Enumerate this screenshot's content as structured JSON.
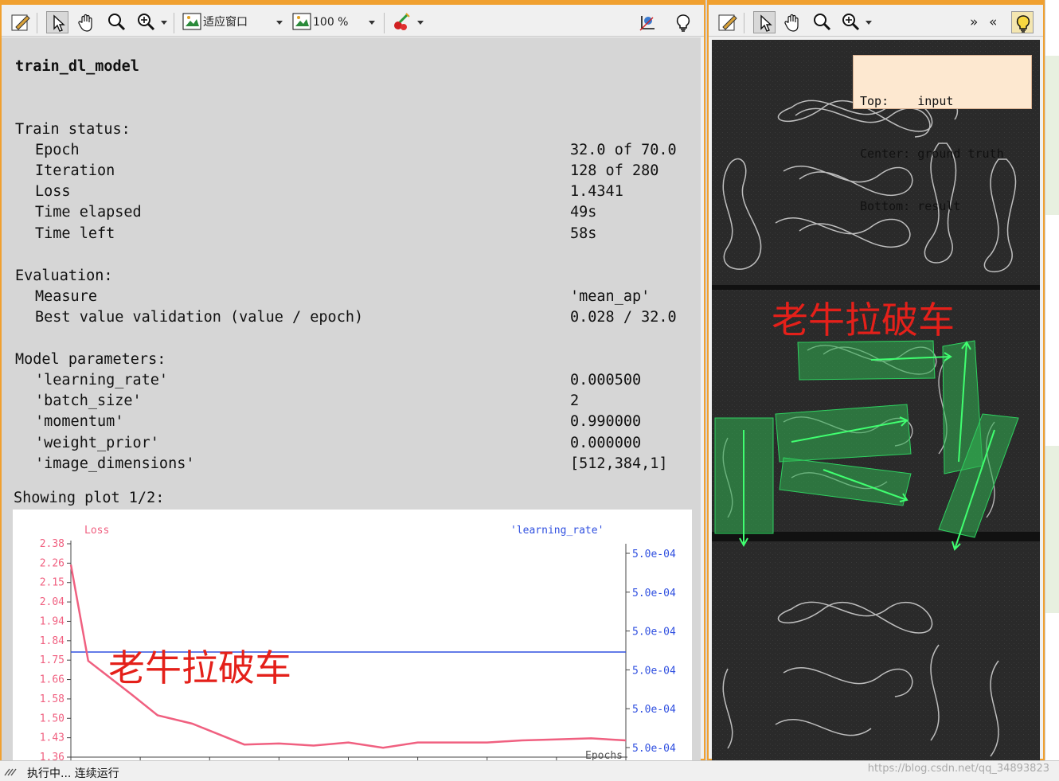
{
  "left_window": {
    "toolbar": {
      "zoom_mode": "适应窗口",
      "zoom_percent": "100 %"
    },
    "title": "train_dl_model",
    "train_status": {
      "heading": "Train status:",
      "rows": [
        {
          "label": "Epoch",
          "value": "32.0 of 70.0"
        },
        {
          "label": "Iteration",
          "value": "128 of 280"
        },
        {
          "label": "Loss",
          "value": "1.4341"
        },
        {
          "label": "Time elapsed",
          "value": "49s"
        },
        {
          "label": "Time left",
          "value": "58s"
        }
      ]
    },
    "evaluation": {
      "heading": "Evaluation:",
      "rows": [
        {
          "label": "Measure",
          "value": "'mean_ap'"
        },
        {
          "label": "Best value validation (value / epoch)",
          "value": "0.028 / 32.0"
        }
      ]
    },
    "model_parameters": {
      "heading": "Model parameters:",
      "rows": [
        {
          "label": "'learning_rate'",
          "value": "0.000500"
        },
        {
          "label": "'batch_size'",
          "value": "2"
        },
        {
          "label": "'momentum'",
          "value": "0.990000"
        },
        {
          "label": "'weight_prior'",
          "value": "0.000000"
        },
        {
          "label": "'image_dimensions'",
          "value": "[512,384,1]"
        }
      ]
    },
    "plot_caption": "Showing plot 1/2:",
    "watermark": "老牛拉破车"
  },
  "chart_data": {
    "type": "line",
    "left_series_label": "Loss",
    "right_series_label": "'learning_rate'",
    "xlabel": "Epochs",
    "left_axis_ticks": [
      "2.38",
      "2.26",
      "2.15",
      "2.04",
      "1.94",
      "1.84",
      "1.75",
      "1.66",
      "1.58",
      "1.50",
      "1.43",
      "1.36"
    ],
    "right_axis_ticks": [
      "5.0e-04",
      "5.0e-04",
      "5.0e-04",
      "5.0e-04",
      "5.0e-04",
      "5.0e-04"
    ],
    "ylim_left": [
      1.36,
      2.38
    ],
    "xlim": [
      0,
      32
    ],
    "series": [
      {
        "name": "Loss",
        "color": "#f06080",
        "x": [
          0,
          1,
          3.5,
          5,
          7,
          10,
          12,
          14,
          16,
          18,
          20,
          22,
          24,
          26,
          28,
          30,
          32
        ],
        "y": [
          2.28,
          1.82,
          1.66,
          1.56,
          1.52,
          1.42,
          1.425,
          1.415,
          1.43,
          1.405,
          1.43,
          1.43,
          1.43,
          1.44,
          1.445,
          1.45,
          1.44
        ]
      },
      {
        "name": "'learning_rate'",
        "color": "#3050e0",
        "x": [
          0,
          32
        ],
        "y_right": [
          0.0005,
          0.0005
        ]
      }
    ]
  },
  "right_window": {
    "legend_lines": [
      "Top:    input",
      "Center: ground truth",
      "Bottom: result"
    ],
    "watermark": "老牛拉破车"
  },
  "status_bar": {
    "text": "执行中... 连续运行",
    "watermark_url": "https://blog.csdn.net/qq_34893823"
  }
}
